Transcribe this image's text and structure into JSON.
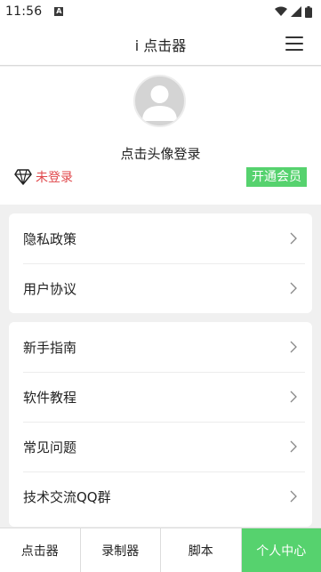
{
  "status_bar": {
    "time": "11:56",
    "notification_icon": "A"
  },
  "header": {
    "title": "i 点击器",
    "menu_icon": "hamburger-menu-icon"
  },
  "profile": {
    "login_prompt": "点击头像登录",
    "member_status": "未登录",
    "open_vip_label": "开通会员",
    "status_color": "#e0474b",
    "vip_color": "#56d26e"
  },
  "card1": {
    "items": [
      {
        "label": "隐私政策"
      },
      {
        "label": "用户协议"
      }
    ]
  },
  "card2": {
    "items": [
      {
        "label": "新手指南"
      },
      {
        "label": "软件教程"
      },
      {
        "label": "常见问题"
      },
      {
        "label": "技术交流QQ群"
      }
    ]
  },
  "bottom_nav": {
    "tabs": [
      {
        "label": "点击器"
      },
      {
        "label": "录制器"
      },
      {
        "label": "脚本"
      },
      {
        "label": "个人中心"
      }
    ],
    "active_tab": "个人中心",
    "active_color": "#56d26e"
  }
}
